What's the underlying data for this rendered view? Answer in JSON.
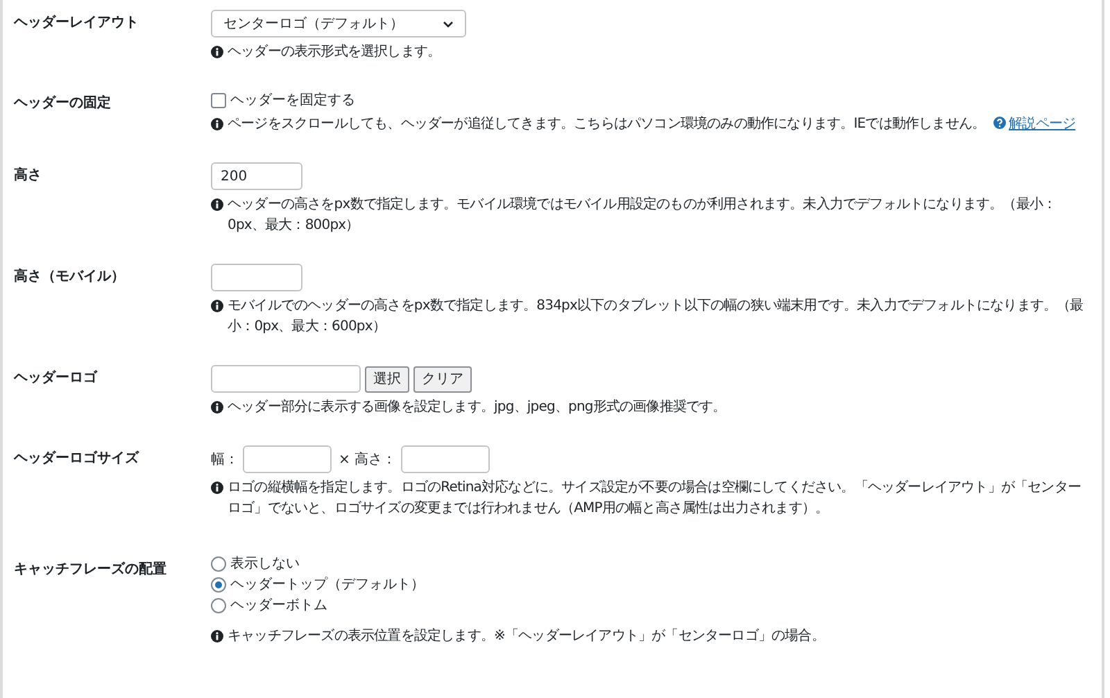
{
  "rows": [
    {
      "kind": "select",
      "label": "ヘッダーレイアウト",
      "value": "センターロゴ（デフォルト）",
      "help": "ヘッダーの表示形式を選択します。"
    },
    {
      "kind": "checkbox",
      "label": "ヘッダーの固定",
      "option": "ヘッダーを固定する",
      "checked": false,
      "help": "ページをスクロールしても、ヘッダーが追従してきます。こちらはパソコン環境のみの動作になります。IEでは動作しません。",
      "link": "解説ページ"
    },
    {
      "kind": "text",
      "label": "高さ",
      "value": "200",
      "help": "ヘッダーの高さをpx数で指定します。モバイル環境ではモバイル用設定のものが利用されます。未入力でデフォルトになります。（最小：0px、最大：800px）"
    },
    {
      "kind": "text",
      "label": "高さ（モバイル）",
      "help": "モバイルでのヘッダーの高さをpx数で指定します。834px以下のタブレット以下の幅の狭い端末用です。未入力でデフォルトになります。（最小：0px、最大：600px）"
    },
    {
      "kind": "file",
      "label": "ヘッダーロゴ",
      "buttons": [
        "選択",
        "クリア"
      ],
      "help": "ヘッダー部分に表示する画像を設定します。jpg、jpeg、png形式の画像推奨です。"
    },
    {
      "kind": "size",
      "label": "ヘッダーロゴサイズ",
      "width_label": "幅：",
      "height_label": "× 高さ：",
      "help": "ロゴの縦横幅を指定します。ロゴのRetina対応などに。サイズ設定が不要の場合は空欄にしてください。「ヘッダーレイアウト」が「センターロゴ」でないと、ロゴサイズの変更までは行われません（AMP用の幅と高さ属性は出力されます）。"
    },
    {
      "kind": "radio",
      "label": "キャッチフレーズの配置",
      "options": [
        {
          "label": "表示しない",
          "selected": false
        },
        {
          "label": "ヘッダートップ（デフォルト）",
          "selected": true
        },
        {
          "label": "ヘッダーボトム",
          "selected": false
        }
      ],
      "help": "キャッチフレーズの表示位置を設定します。※「ヘッダーレイアウト」が「センターロゴ」の場合。"
    }
  ]
}
